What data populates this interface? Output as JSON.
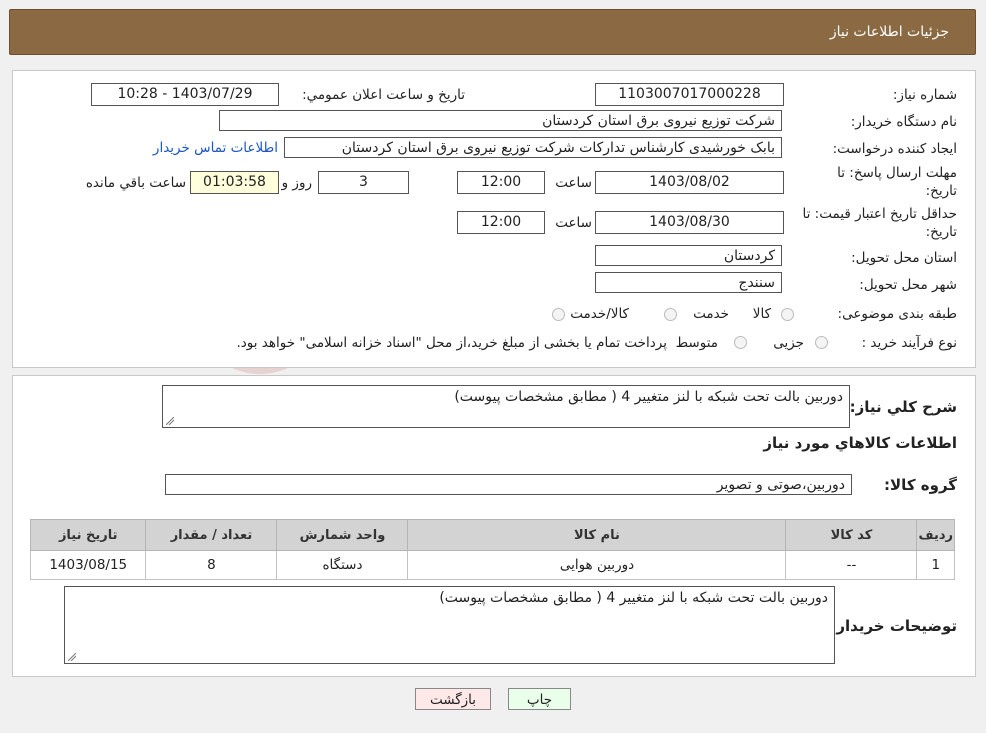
{
  "header": {
    "title": "جزئیات اطلاعات نیاز"
  },
  "form": {
    "need_number_label": "شماره نیاز:",
    "need_number": "1103007017000228",
    "announce_label": "تاريخ و ساعت اعلان عمومي:",
    "announce_value": "1403/07/29 - 10:28",
    "buyer_org_label": "نام دستگاه خريدار:",
    "buyer_org": "شرکت توزیع نیروی برق استان کردستان",
    "creator_label": "ايجاد کننده درخواست:",
    "creator": "بابک خورشیدی کارشناس تدارکات شرکت توزیع نیروی برق استان کردستان",
    "contact_link": "اطلاعات تماس خريدار",
    "deadline_label_1": "مهلت ارسال پاسخ: تا",
    "deadline_label_2": "تاريخ:",
    "deadline_date": "1403/08/02",
    "time_word": "ساعت",
    "deadline_time": "12:00",
    "days_value": "3",
    "days_word": "روز و",
    "remaining_time": "01:03:58",
    "remaining_word": "ساعت باقي مانده",
    "validity_label_1": "حداقل تاريخ اعتبار قيمت: تا",
    "validity_label_2": "تاريخ:",
    "validity_date": "1403/08/30",
    "validity_time": "12:00",
    "province_label": "استان محل تحويل:",
    "province": "کردستان",
    "city_label": "شهر محل تحويل:",
    "city": "سنندج",
    "category_label": "طبقه بندی موضوعی:",
    "category_options": [
      "کالا",
      "خدمت",
      "کالا/خدمت"
    ],
    "process_label": "نوع فرآيند خريد :",
    "process_options": [
      "جزیی",
      "متوسط"
    ],
    "process_note": "پرداخت تمام يا بخشی از مبلغ خريد،از محل \"اسناد خزانه اسلامی\" خواهد بود."
  },
  "details": {
    "summary_label": "شرح کلي نياز:",
    "summary": "دوربین بالت تحت شبکه با لنز متغییر 4 ( مطابق مشخصات پیوست)",
    "goods_info_title": "اطلاعات کالاهاي مورد نياز",
    "goods_group_label": "گروه کالا:",
    "goods_group": "دوربین،صوتی و تصویر",
    "table": {
      "headers": [
        "رديف",
        "کد کالا",
        "نام کالا",
        "واحد شمارش",
        "تعداد / مقدار",
        "تاريخ نياز"
      ],
      "rows": [
        [
          "1",
          "--",
          "دوربین هوایی",
          "دستگاه",
          "8",
          "1403/08/15"
        ]
      ]
    },
    "buyer_notes_label": "توضيحات خريدار:",
    "buyer_notes": "دوربین بالت تحت شبکه با لنز متغییر 4 ( مطابق مشخصات پیوست)"
  },
  "buttons": {
    "print": "چاپ",
    "back": "بازگشت"
  },
  "watermark_text": "AriaTender.neT",
  "colors": {
    "header_bg": "#8b6a43",
    "link": "#1a56c4",
    "print_bg": "#eaffea",
    "back_bg": "#ffe8e8"
  }
}
